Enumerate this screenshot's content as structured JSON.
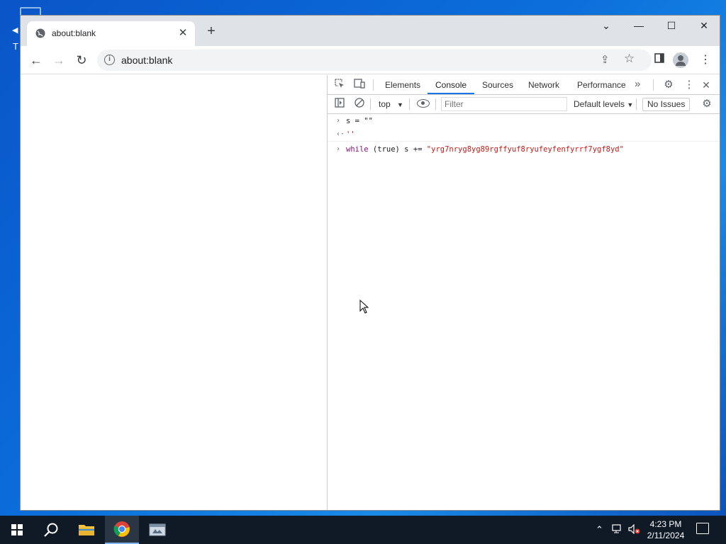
{
  "browser": {
    "tab_title": "about:blank",
    "tab_close": "✕",
    "new_tab": "+",
    "url": "about:blank",
    "window_controls": {
      "dropdown": "⌄",
      "minimize": "—",
      "maximize": "☐",
      "close": "✕"
    }
  },
  "devtools": {
    "tabs": [
      "Elements",
      "Console",
      "Sources",
      "Network",
      "Performance"
    ],
    "active_tab": "Console",
    "more_tabs": "»",
    "context": "top",
    "filter_placeholder": "Filter",
    "levels": "Default levels",
    "issues": "No Issues",
    "console": {
      "lines": [
        {
          "type": "input",
          "prompt": "›",
          "text": "s = \"\""
        },
        {
          "type": "output",
          "prompt": "‹·",
          "text": "''"
        },
        {
          "type": "input",
          "prompt": "›",
          "keyword": "while",
          "rest": " (true) s += ",
          "string": "\"yrg7nryg8yg89rgffyuf8ryufeyfenfyrrf7ygf8yd\""
        }
      ]
    }
  },
  "taskbar": {
    "time": "4:23 PM",
    "date": "2/11/2024"
  },
  "colors": {
    "accent": "#1a73e8",
    "console_keyword": "#881280",
    "console_string": "#c41a16",
    "taskbar": "#101a26"
  }
}
